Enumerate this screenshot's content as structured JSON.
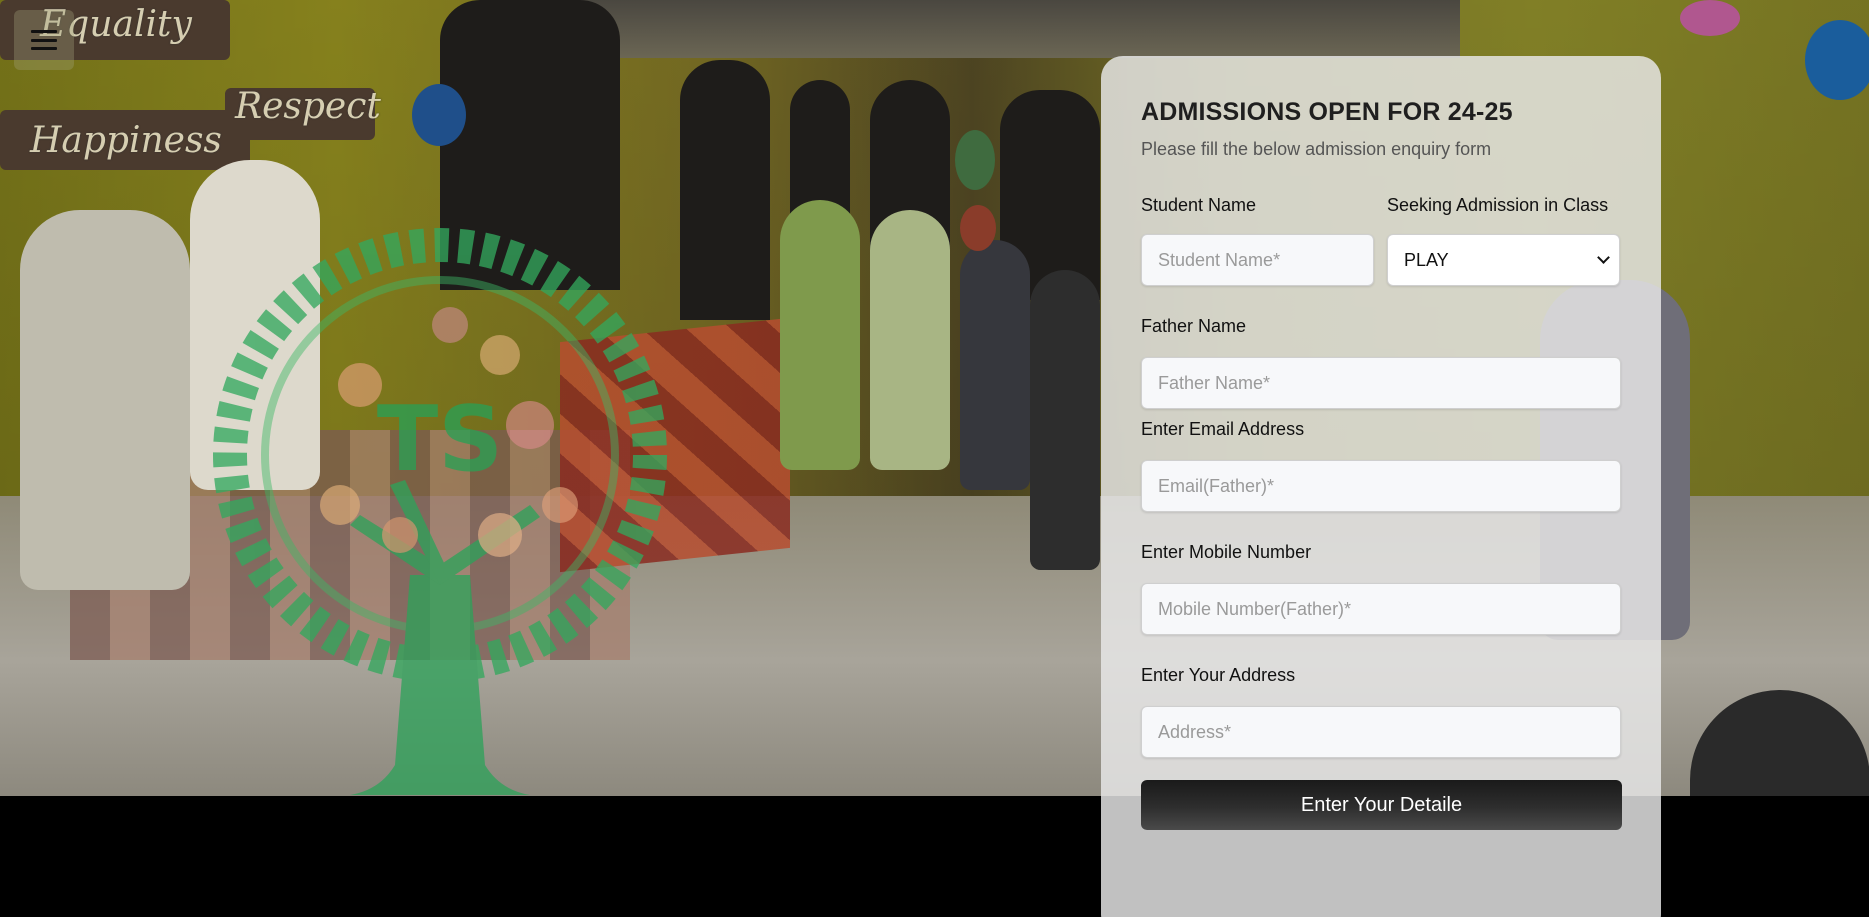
{
  "menu": {
    "icon": "hamburger-menu-icon"
  },
  "background": {
    "wall_words": [
      "Equality",
      "Respect",
      "Happiness"
    ],
    "logo_letters": "TS"
  },
  "form": {
    "title": "ADMISSIONS OPEN FOR 24-25",
    "subtitle": "Please fill the below admission enquiry form",
    "student_name": {
      "label": "Student Name",
      "placeholder": "Student Name*"
    },
    "class": {
      "label": "Seeking Admission in Class",
      "selected": "PLAY",
      "icon": "chevron-down-icon"
    },
    "father_name": {
      "label": "Father Name",
      "placeholder": "Father Name*"
    },
    "email": {
      "label": "Enter Email Address",
      "placeholder": "Email(Father)*"
    },
    "mobile": {
      "label": "Enter Mobile Number",
      "placeholder": "Mobile Number(Father)*"
    },
    "address": {
      "label": "Enter Your Address",
      "placeholder": "Address*"
    },
    "submit_label": "Enter Your Detaile"
  }
}
